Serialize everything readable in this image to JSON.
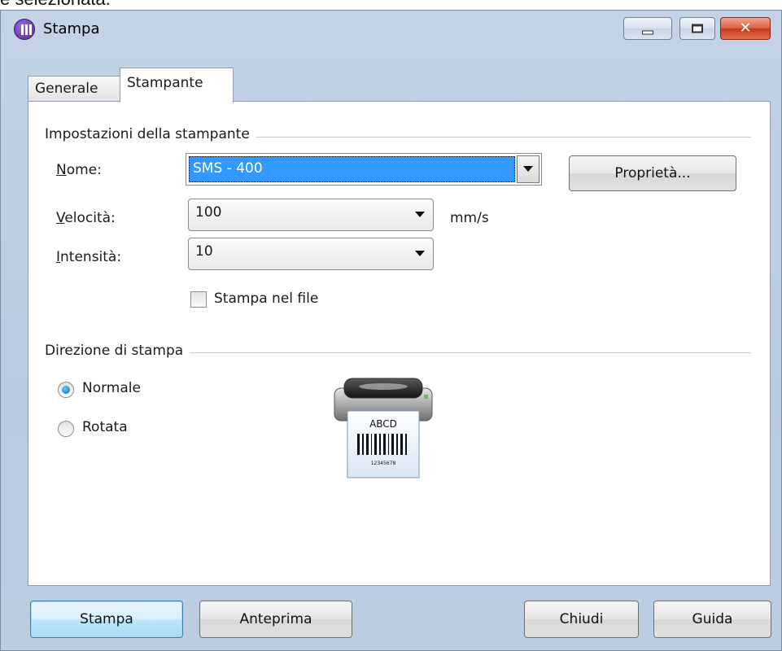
{
  "caption": "è selezionata.",
  "window": {
    "title": "Stampa",
    "close_glyph": "✕"
  },
  "tabs": [
    {
      "label": "Generale",
      "active": false
    },
    {
      "label": "Stampante",
      "active": true
    }
  ],
  "printer_settings": {
    "group_title": "Impostazioni della stampante",
    "name": {
      "label_accel": "N",
      "label_rest": "ome:",
      "value": "SMS - 400"
    },
    "properties_button": "Proprietà...",
    "speed": {
      "label_accel": "V",
      "label_rest": "elocità:",
      "value": "100",
      "unit": "mm/s"
    },
    "intensity": {
      "label_accel": "I",
      "label_rest": "ntensità:",
      "value": "10"
    },
    "print_to_file": {
      "label": "Stampa nel file",
      "checked": false
    }
  },
  "print_direction": {
    "group_title": "Direzione di stampa",
    "options": [
      {
        "label": "Normale",
        "checked": true
      },
      {
        "label": "Rotata",
        "checked": false
      }
    ],
    "preview_text": "ABCD",
    "preview_code": "12345678"
  },
  "footer_buttons": {
    "print": "Stampa",
    "preview": "Anteprima",
    "close": "Chiudi",
    "help": "Guida"
  },
  "colors": {
    "selection": "#3399ff",
    "title_bar": "#bccde2",
    "close_button": "#c8371a"
  },
  "icons": [
    "app-icon",
    "minimize-icon",
    "maximize-icon",
    "close-icon",
    "chevron-down-icon",
    "printer-icon"
  ]
}
